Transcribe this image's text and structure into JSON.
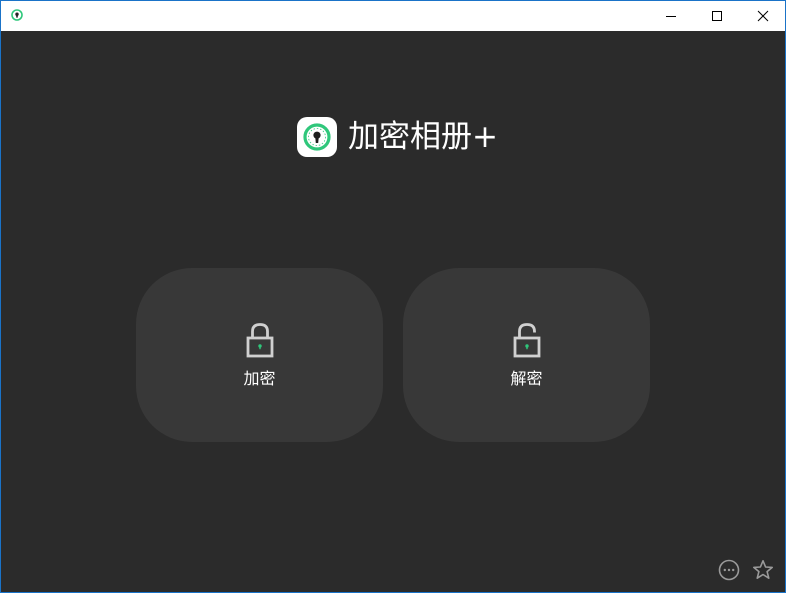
{
  "window": {
    "title_bar_color": "#ffffff",
    "background_color": "#2b2b2b",
    "controls": {
      "minimize_icon": "minimize-icon",
      "maximize_icon": "maximize-icon",
      "close_icon": "close-icon"
    }
  },
  "app": {
    "title": "加密相册+",
    "logo_icon": "keyhole-lock-icon",
    "accent_color": "#2fc77b"
  },
  "actions": {
    "encrypt": {
      "label": "加密",
      "icon": "lock-closed-icon"
    },
    "decrypt": {
      "label": "解密",
      "icon": "lock-open-icon"
    }
  },
  "footer": {
    "more_icon": "more-options-icon",
    "favorite_icon": "star-icon"
  }
}
